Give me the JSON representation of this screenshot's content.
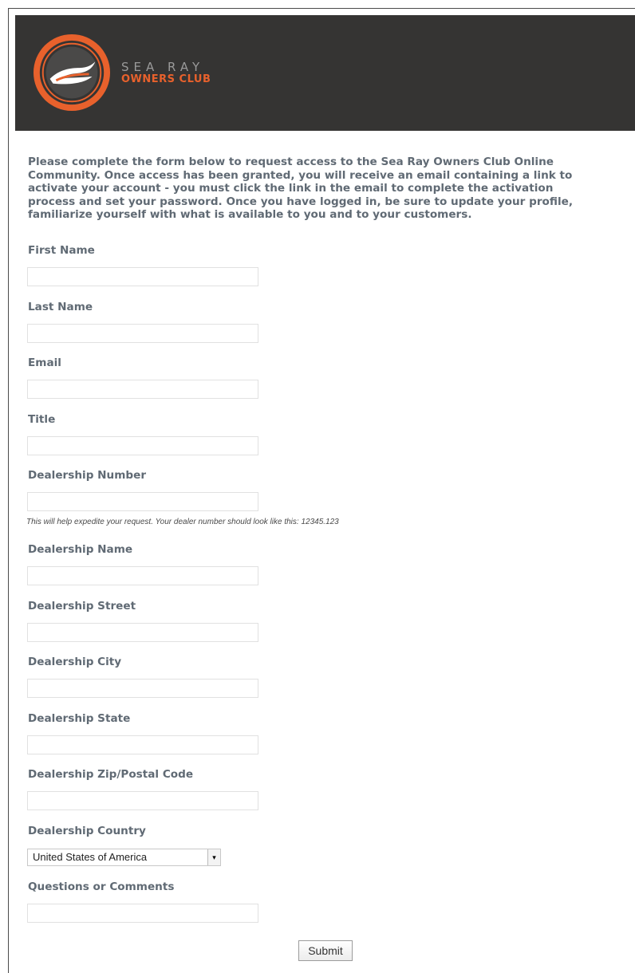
{
  "brand": {
    "line1": "SEA RAY",
    "line2": "OWNERS CLUB",
    "accent_color": "#e8612c",
    "header_bg": "#353433",
    "logo_icon": "sea-ray-logo-icon"
  },
  "intro_text": "Please complete the form below to request access to the Sea Ray Owners Club Online Community. Once access has been granted, you will receive an email containing a link to activate your account - you must click the link in the email to complete the activation process and set your password. Once you have logged in, be sure to update your profile, familiarize yourself with what is available to you and to your customers.",
  "form": {
    "first_name": {
      "label": "First Name",
      "value": ""
    },
    "last_name": {
      "label": "Last Name",
      "value": ""
    },
    "email": {
      "label": "Email",
      "value": ""
    },
    "title": {
      "label": "Title",
      "value": ""
    },
    "dealership_number": {
      "label": "Dealership Number",
      "value": "",
      "hint": "This will help expedite your request. Your dealer number should look like this: 12345.123"
    },
    "dealership_name": {
      "label": "Dealership Name",
      "value": ""
    },
    "dealership_street": {
      "label": "Dealership Street",
      "value": ""
    },
    "dealership_city": {
      "label": "Dealership City",
      "value": ""
    },
    "dealership_state": {
      "label": "Dealership State",
      "value": ""
    },
    "dealership_zip": {
      "label": "Dealership Zip/Postal Code",
      "value": ""
    },
    "dealership_country": {
      "label": "Dealership Country",
      "selected": "United States of America"
    },
    "comments": {
      "label": "Questions or Comments",
      "value": ""
    },
    "submit_label": "Submit"
  }
}
